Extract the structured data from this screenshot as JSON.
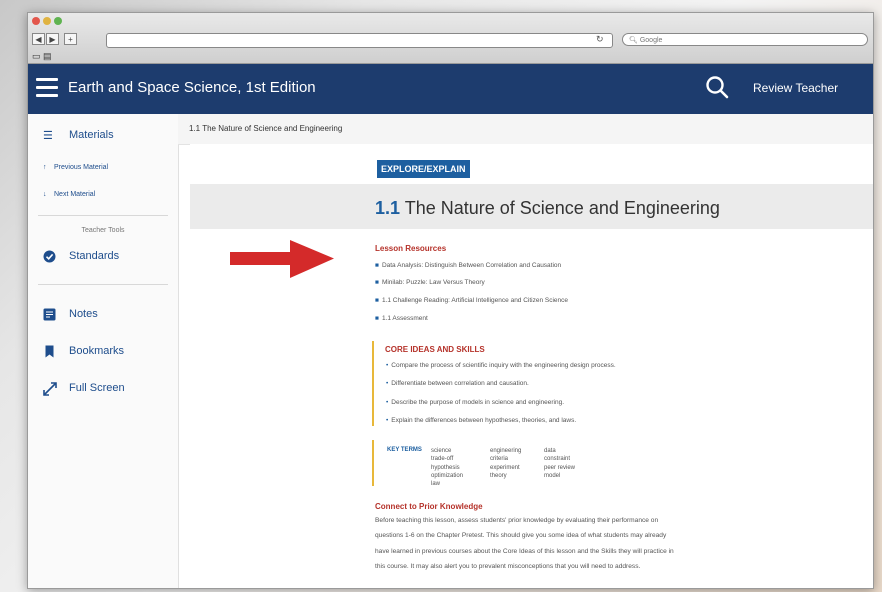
{
  "browser": {
    "search_placeholder": "Google"
  },
  "app": {
    "title": "Earth and Space Science, 1st Edition",
    "review_label": "Review Teacher"
  },
  "sidebar": {
    "materials_label": "Materials",
    "previous_label": "Previous Material",
    "next_label": "Next Material",
    "teacher_tools_label": "Teacher Tools",
    "standards_label": "Standards",
    "notes_label": "Notes",
    "bookmarks_label": "Bookmarks",
    "fullscreen_label": "Full Screen"
  },
  "breadcrumb": "1.1 The Nature of Science and Engineering",
  "content": {
    "badge": "EXPLORE/EXPLAIN",
    "heading_number": "1.1",
    "heading_text": "The Nature of Science and Engineering",
    "lesson_resources_title": "Lesson Resources",
    "lesson_resources": [
      "Data Analysis: Distinguish Between Correlation and Causation",
      "Minilab: Puzzle: Law Versus Theory",
      "1.1 Challenge Reading: Artificial Intelligence and Citizen Science",
      "1.1 Assessment"
    ],
    "core_title": "CORE IDEAS AND SKILLS",
    "core_items": [
      "Compare the process of scientific inquiry with the engineering design process.",
      "Differentiate between correlation and causation.",
      "Describe the purpose of models in science and engineering.",
      "Explain the differences between hypotheses, theories, and laws."
    ],
    "key_terms_label": "KEY TERMS",
    "key_terms_col1": [
      "science",
      "trade-off",
      "hypothesis",
      "optimization",
      "law"
    ],
    "key_terms_col2": [
      "engineering",
      "criteria",
      "experiment",
      "theory"
    ],
    "key_terms_col3": [
      "data",
      "constraint",
      "peer review",
      "model"
    ],
    "connect_title": "Connect to Prior Knowledge",
    "connect_lines": [
      "Before teaching this lesson, assess students' prior knowledge by evaluating their performance on",
      "questions 1-6 on the Chapter Pretest. This should give you some idea of what students may already",
      "have learned in previous courses about the Core Ideas of this lesson and the Skills they will practice in",
      "this course. It may also alert you to prevalent misconceptions that you will need to address."
    ]
  },
  "colors": {
    "appbar": "#1d3c6e",
    "accent_blue": "#1d5fa0",
    "section_red": "#b5322a",
    "arrow_red": "#d42a2a"
  }
}
